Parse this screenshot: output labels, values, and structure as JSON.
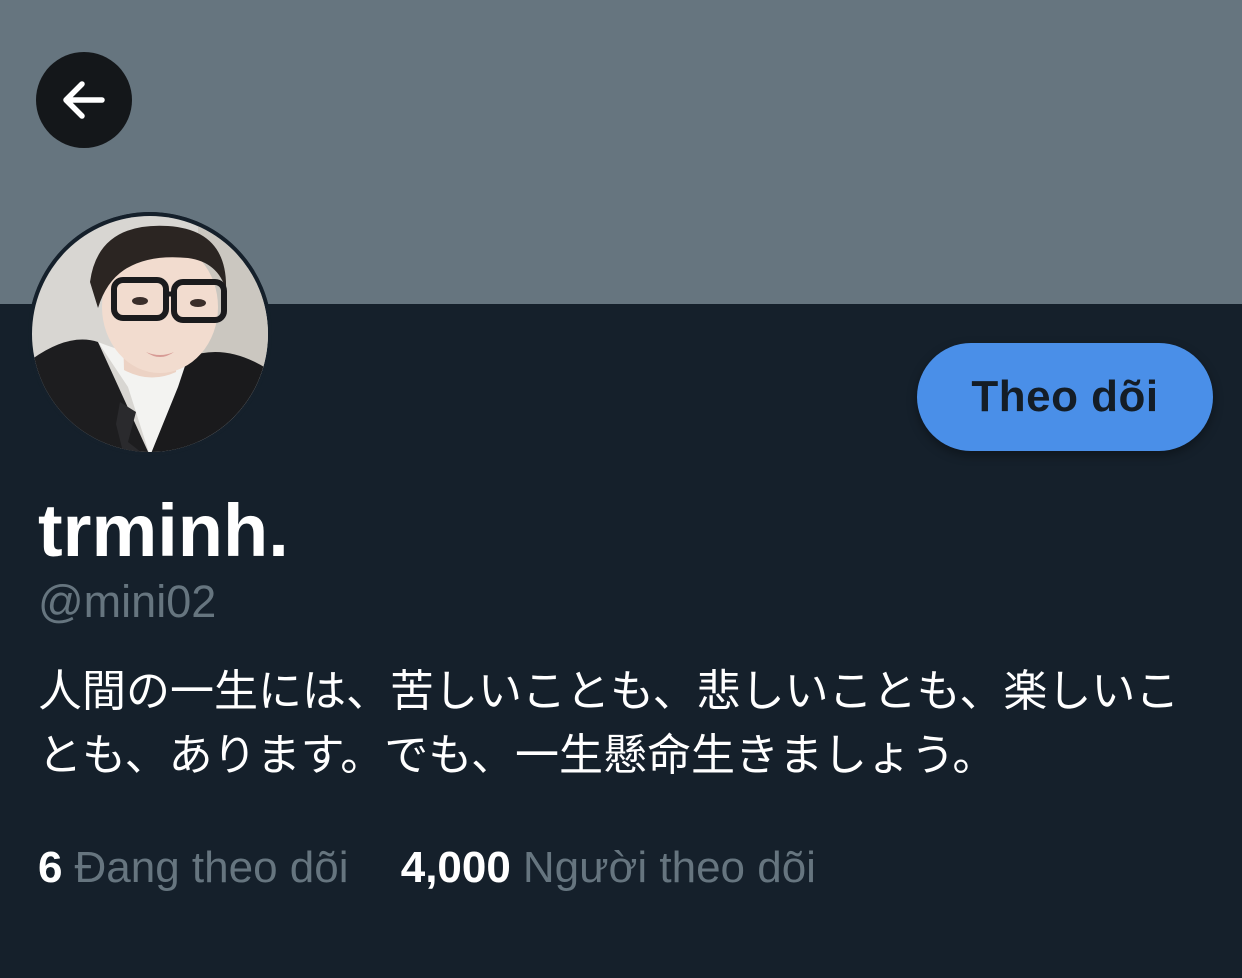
{
  "header": {
    "back_icon": "arrow-left-icon"
  },
  "colors": {
    "background": "#15202b",
    "banner": "#66757f",
    "accent": "#4a8fe8",
    "secondary_text": "#66757f"
  },
  "profile": {
    "display_name": "trminh.",
    "handle": "@mini02",
    "bio": "人間の一生には、苦しいことも、悲しいことも、楽しいことも、あります。でも、一生懸命生きましょう。",
    "follow_label": "Theo dõi"
  },
  "stats": {
    "following_count": "6",
    "following_label": "Đang theo dõi",
    "followers_count": "4,000",
    "followers_label": "Người theo dõi"
  }
}
